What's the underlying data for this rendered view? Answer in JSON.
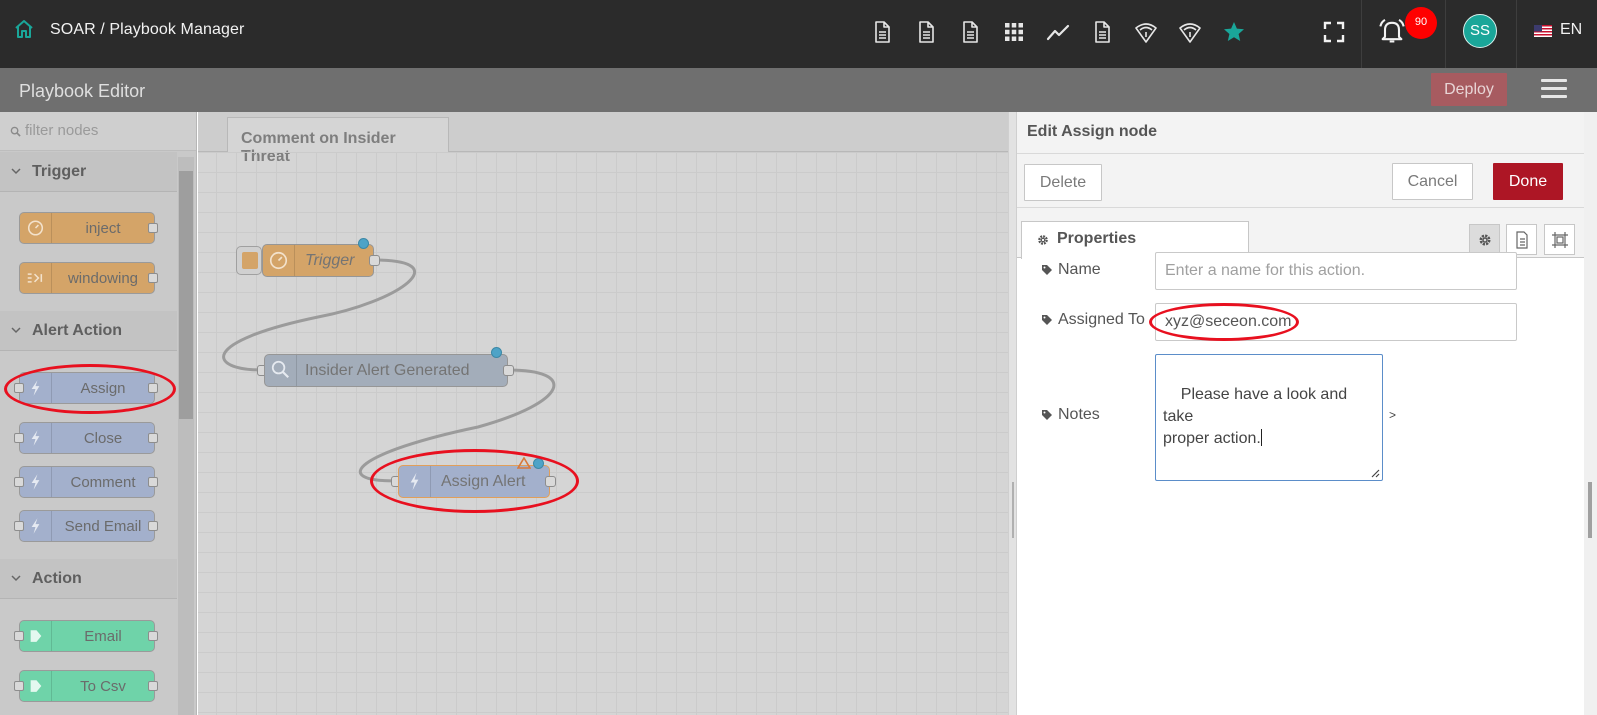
{
  "topbar": {
    "breadcrumb": "SOAR / Playbook Manager",
    "notification_count": "90",
    "avatar_initials": "SS",
    "language": "EN",
    "icons": [
      "document-icon",
      "document-icon",
      "document-icon",
      "grid-icon",
      "trend-icon",
      "document-icon",
      "wifi-icon",
      "wifi-icon",
      "star-icon",
      "fullscreen-icon",
      "bell-icon"
    ]
  },
  "editor": {
    "title": "Playbook Editor",
    "deploy_label": "Deploy"
  },
  "palette": {
    "filter_placeholder": "filter nodes",
    "categories": [
      {
        "label": "Trigger",
        "nodes": [
          "inject",
          "windowing"
        ]
      },
      {
        "label": "Alert Action",
        "nodes": [
          "Assign",
          "Close",
          "Comment",
          "Send Email"
        ]
      },
      {
        "label": "Action",
        "nodes": [
          "Email",
          "To Csv"
        ]
      }
    ]
  },
  "workspace": {
    "tab_label": "Comment on Insider Threat",
    "nodes": {
      "trigger": "Trigger",
      "insider_alert": "Insider Alert Generated",
      "assign_alert": "Assign Alert"
    }
  },
  "panel": {
    "title": "Edit Assign node",
    "delete_label": "Delete",
    "cancel_label": "Cancel",
    "done_label": "Done",
    "properties_tab": "Properties",
    "fields": {
      "name_label": "Name",
      "name_placeholder": "Enter a name for this action.",
      "assigned_label": "Assigned To",
      "assigned_value": "xyz@seceon.com",
      "notes_label": "Notes",
      "notes_value": "Please have a look and take\nproper action.",
      "notes_chevron": ">"
    }
  },
  "colors": {
    "accent": "#ad1625",
    "trigger_node": "#d4a468",
    "alert_node": "#a3b0cc",
    "action_node": "#6fd3a9",
    "highlight": "#e8101f",
    "avatar": "#1aa699"
  }
}
